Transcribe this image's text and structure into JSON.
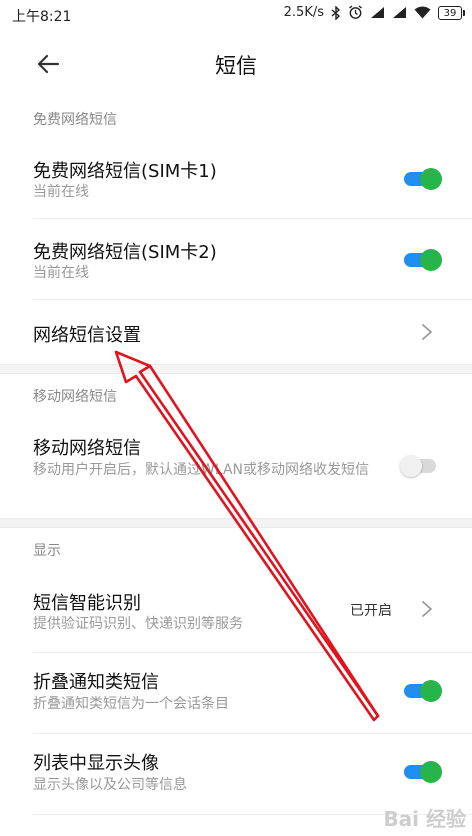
{
  "status_bar": {
    "time": "上午8:21",
    "network_speed": "2.5K/s",
    "battery_level": "39",
    "icons": [
      "bluetooth-icon",
      "alarm-icon",
      "signal-icon",
      "signal-icon",
      "wifi-icon",
      "battery-icon"
    ]
  },
  "header": {
    "title": "短信",
    "back_icon": "back-arrow-icon"
  },
  "sections": [
    {
      "header": "免费网络短信",
      "rows": [
        {
          "title": "免费网络短信(SIM卡1)",
          "subtitle": "当前在线",
          "control": "toggle",
          "value": true
        },
        {
          "title": "免费网络短信(SIM卡2)",
          "subtitle": "当前在线",
          "control": "toggle",
          "value": true
        },
        {
          "title": "网络短信设置",
          "control": "chevron"
        }
      ]
    },
    {
      "header": "移动网络短信",
      "rows": [
        {
          "title": "移动网络短信",
          "subtitle": "移动用户开启后，默认通过WLAN或移动网络收发短信",
          "control": "toggle",
          "value": false
        }
      ]
    },
    {
      "header": "显示",
      "rows": [
        {
          "title": "短信智能识别",
          "subtitle": "提供验证码识别、快递识别等服务",
          "control": "chevron",
          "status": "已开启"
        },
        {
          "title": "折叠通知类短信",
          "subtitle": "折叠通知类短信为一个会话条目",
          "control": "toggle",
          "value": true
        },
        {
          "title": "列表中显示头像",
          "subtitle": "显示头像以及公司等信息",
          "control": "toggle",
          "value": true
        }
      ]
    }
  ],
  "colors": {
    "toggle_track_on": "#1e8ef0",
    "toggle_knob_on": "#26b54a",
    "annotation_arrow": "#e0141e"
  },
  "watermark": "Bai 经验"
}
